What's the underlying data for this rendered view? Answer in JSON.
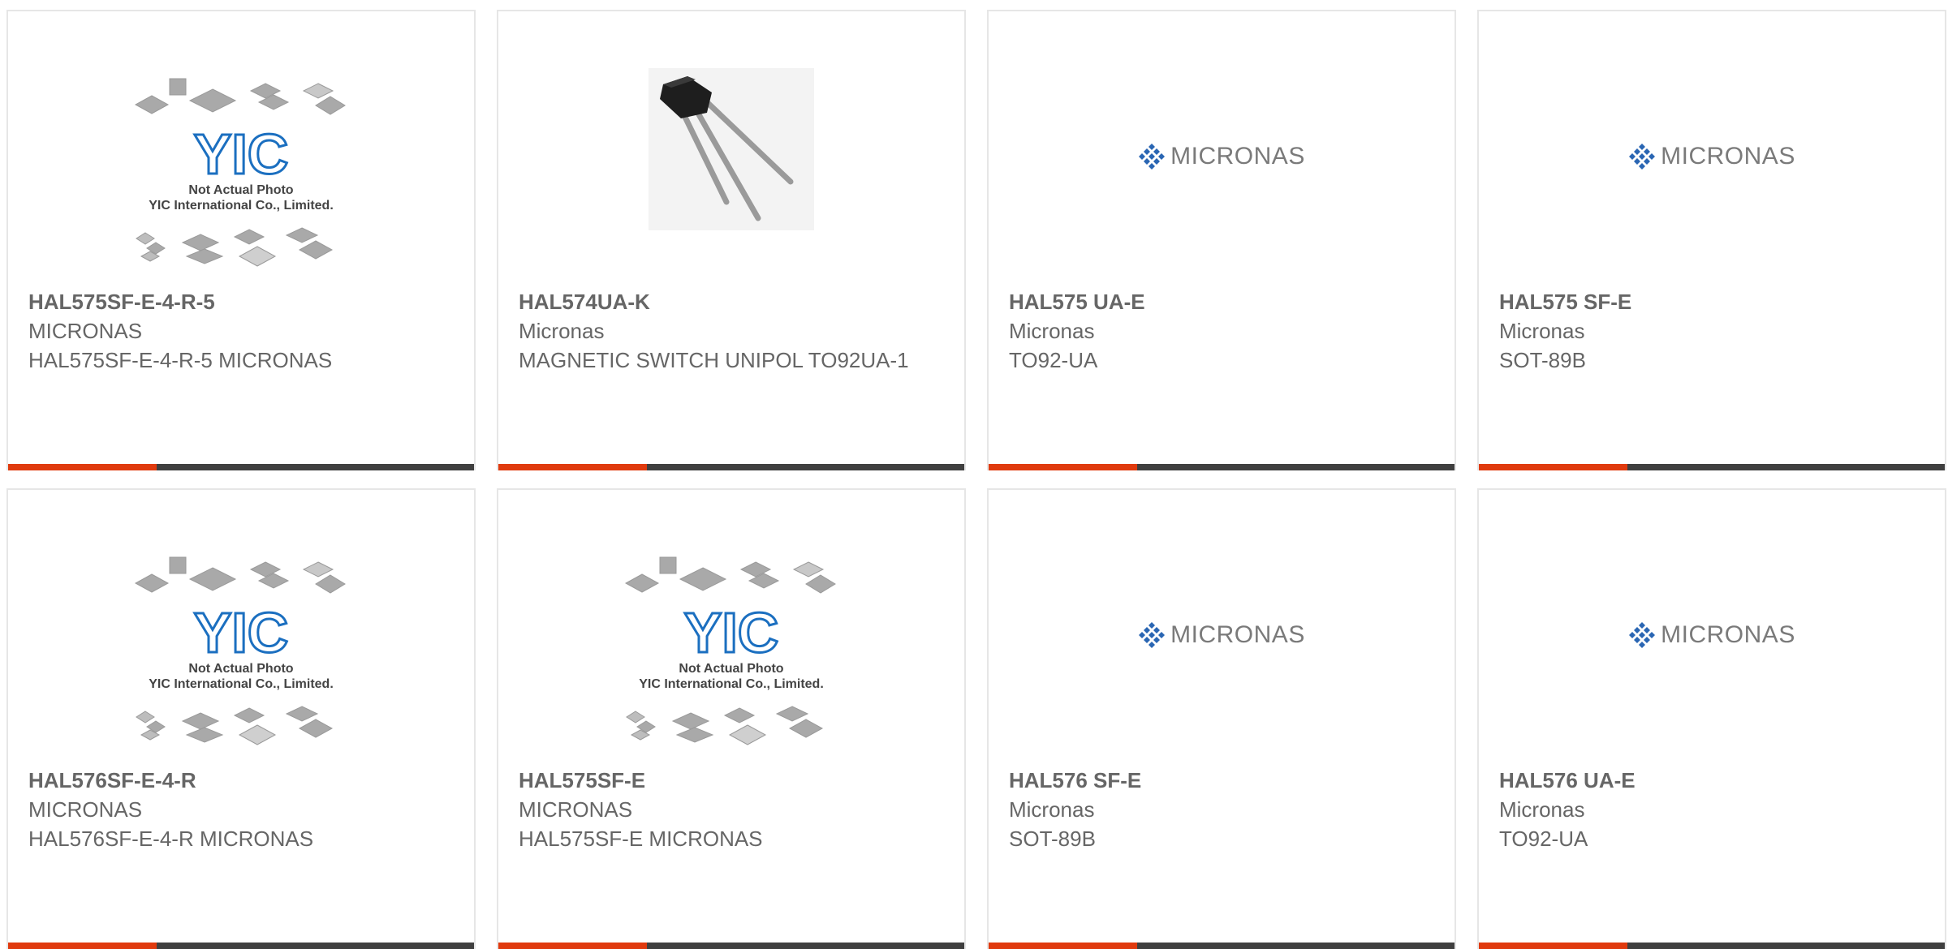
{
  "products": [
    {
      "part": "HAL575SF-E-4-R-5",
      "manufacturer": "MICRONAS",
      "description": "HAL575SF-E-4-R-5 MICRONAS",
      "image": "placeholder-photo"
    },
    {
      "part": "HAL574UA-K",
      "manufacturer": "Micronas",
      "description": "MAGNETIC SWITCH UNIPOL TO92UA-1",
      "image": "transistor-photo"
    },
    {
      "part": "HAL575 UA-E",
      "manufacturer": "Micronas",
      "description": "TO92-UA",
      "image": "micronas-logo"
    },
    {
      "part": "HAL575 SF-E",
      "manufacturer": "Micronas",
      "description": "SOT-89B",
      "image": "micronas-logo"
    },
    {
      "part": "HAL576SF-E-4-R",
      "manufacturer": "MICRONAS",
      "description": "HAL576SF-E-4-R MICRONAS",
      "image": "placeholder-photo"
    },
    {
      "part": "HAL575SF-E",
      "manufacturer": "MICRONAS",
      "description": "HAL575SF-E MICRONAS",
      "image": "placeholder-photo"
    },
    {
      "part": "HAL576 SF-E",
      "manufacturer": "Micronas",
      "description": "SOT-89B",
      "image": "micronas-logo"
    },
    {
      "part": "HAL576 UA-E",
      "manufacturer": "Micronas",
      "description": "TO92-UA",
      "image": "micronas-logo"
    }
  ],
  "placeholder": {
    "line1": "Not Actual Photo",
    "line2": "YIC International Co., Limited.",
    "logo_text": "YIC"
  },
  "micronas_logo_text": "MICRONAS",
  "colors": {
    "accent": "#e03a0e",
    "bar": "#3f3f3f",
    "text": "#666666",
    "yic_blue": "#1b6fc0",
    "micronas_blue": "#2a66b3"
  }
}
